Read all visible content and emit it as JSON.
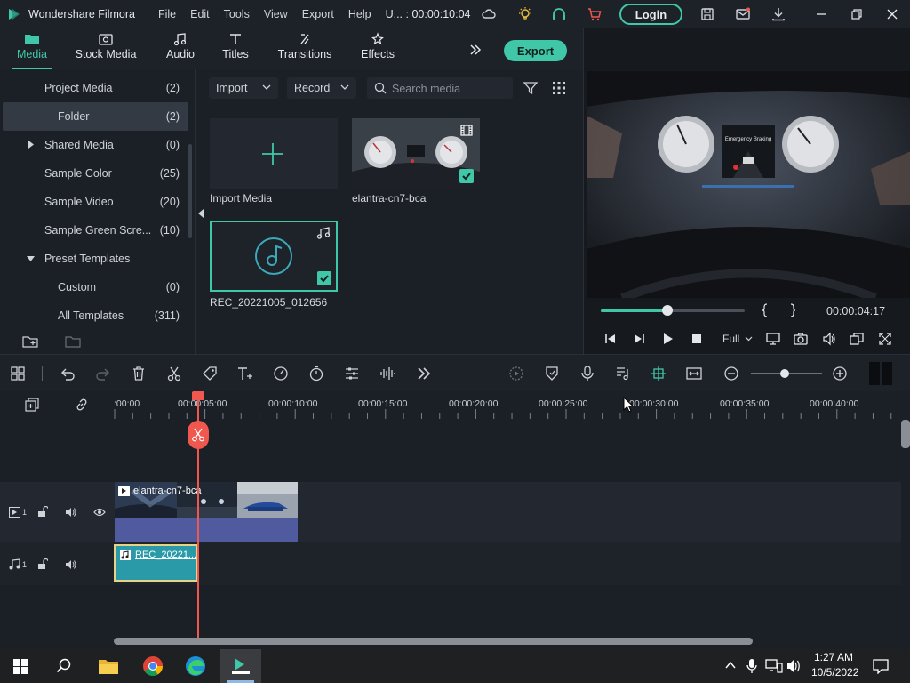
{
  "title_bar": {
    "app_name": "Wondershare Filmora",
    "menu": [
      "File",
      "Edit",
      "Tools",
      "View",
      "Export",
      "Help"
    ],
    "project_time": "U... : 00:00:10:04",
    "login_label": "Login"
  },
  "tabs": [
    {
      "label": "Media",
      "icon": "folder-icon",
      "active": true
    },
    {
      "label": "Stock Media",
      "icon": "stock-media-icon",
      "active": false
    },
    {
      "label": "Audio",
      "icon": "music-note-icon",
      "active": false
    },
    {
      "label": "Titles",
      "icon": "text-t-icon",
      "active": false
    },
    {
      "label": "Transitions",
      "icon": "transition-icon",
      "active": false
    },
    {
      "label": "Effects",
      "icon": "effects-icon",
      "active": false
    }
  ],
  "export_label": "Export",
  "tree": [
    {
      "label": "Project Media",
      "count": "(2)",
      "caret": "down"
    },
    {
      "label": "Folder",
      "count": "(2)",
      "selected": true
    },
    {
      "label": "Shared Media",
      "count": "(0)",
      "caret": "right"
    },
    {
      "label": "Sample Color",
      "count": "(25)"
    },
    {
      "label": "Sample Video",
      "count": "(20)"
    },
    {
      "label": "Sample Green Scre...",
      "count": "(10)"
    },
    {
      "label": "Preset Templates",
      "count": "",
      "caret": "down"
    },
    {
      "label": "Custom",
      "count": "(0)"
    },
    {
      "label": "All Templates",
      "count": "(311)"
    }
  ],
  "media_toolbar": {
    "import_label": "Import",
    "record_label": "Record",
    "search_placeholder": "Search media"
  },
  "media_items": [
    {
      "label": "Import Media"
    },
    {
      "label": "elantra-cn7-bca"
    },
    {
      "label": "REC_20221005_012656"
    }
  ],
  "preview": {
    "timecode": "00:00:04:17",
    "progress": 0.46,
    "quality": "Full",
    "video_text": "Emergency Braking"
  },
  "ruler_labels": [
    ":00:00",
    "00:00:05:00",
    "00:00:10:00",
    "00:00:15:00",
    "00:00:20:00",
    "00:00:25:00",
    "00:00:30:00",
    "00:00:35:00",
    "00:00:40:00"
  ],
  "tracks": {
    "video_label": "1",
    "audio_label": "1",
    "video_clip": "elantra-cn7-bca",
    "audio_clip": "REC_20221..."
  },
  "taskbar": {
    "time": "1:27 AM",
    "date": "10/5/2022"
  },
  "colors": {
    "accent": "#40c7a8",
    "playhead": "#f0584f"
  }
}
